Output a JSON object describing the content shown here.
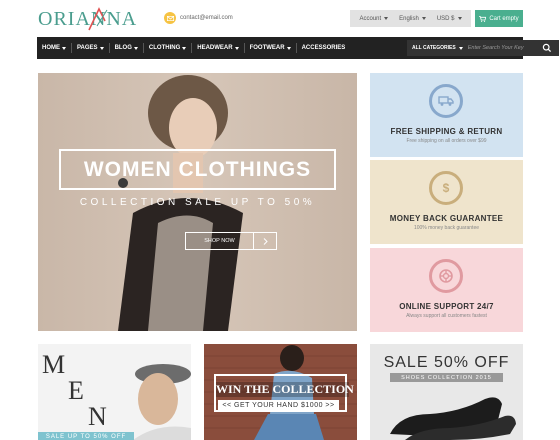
{
  "header": {
    "logo_text": "ORIANNA",
    "contact_email": "contact@email.com",
    "account_label": "Account",
    "language_label": "English",
    "currency_label": "USD $",
    "cart_label": "Cart empty"
  },
  "nav": {
    "items": [
      {
        "label": "HOME",
        "has_dropdown": true
      },
      {
        "label": "PAGES",
        "has_dropdown": true
      },
      {
        "label": "BLOG",
        "has_dropdown": true
      },
      {
        "label": "CLOTHING",
        "has_dropdown": true
      },
      {
        "label": "HEADWEAR",
        "has_dropdown": true
      },
      {
        "label": "FOOTWEAR",
        "has_dropdown": true
      },
      {
        "label": "ACCESSORIES",
        "has_dropdown": false
      }
    ],
    "category_label": "ALL CATEGORIES",
    "search_placeholder": "Enter Search Your Key"
  },
  "hero": {
    "title": "WOMEN CLOTHINGS",
    "subtitle": "COLLECTION SALE UP TO 50%",
    "button_label": "SHOP NOW"
  },
  "services": [
    {
      "title": "FREE SHIPPING & RETURN",
      "desc": "Free shipping on all orders over $99",
      "icon": "truck-icon",
      "color": "#d2e3f1"
    },
    {
      "title": "MONEY BACK GUARANTEE",
      "desc": "100% money back guarantee",
      "icon": "dollar-icon",
      "color": "#efe4cc"
    },
    {
      "title": "ONLINE SUPPORT 24/7",
      "desc": "Always support all customers fastest",
      "icon": "lifebuoy-icon",
      "color": "#f8d7da"
    }
  ],
  "banners": {
    "men": {
      "letters": [
        "M",
        "E",
        "N"
      ],
      "sale_text": "SALE UP TO 50% OFF"
    },
    "collection": {
      "title": "WIN THE COLLECTION",
      "subtitle": "<< GET YOUR HAND $1000 >>"
    },
    "shoes": {
      "title": "SALE 50% OFF",
      "subtitle": "SHOES COLLECTION 2015"
    }
  },
  "colors": {
    "brand": "#4a9d8e",
    "cart": "#4aaf8f",
    "nav_bg": "#222222",
    "accent_yellow": "#f6c343"
  }
}
